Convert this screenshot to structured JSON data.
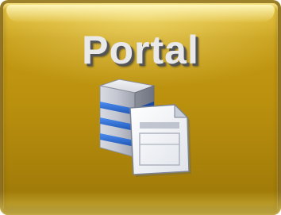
{
  "tile": {
    "title": "Portal",
    "icon": "server-document-icon"
  },
  "colors": {
    "tile_gold": "#b98f0e",
    "title_text": "#e9e9e9",
    "title_shadow": "#555555",
    "server_stripe_blue": "#2b6fd6"
  }
}
